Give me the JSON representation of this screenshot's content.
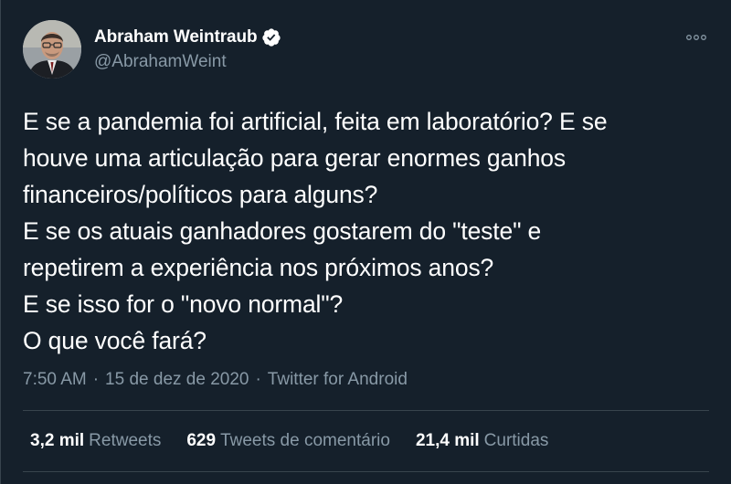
{
  "author": {
    "display_name": "Abraham Weintraub",
    "handle": "@AbrahamWeint",
    "verified": true,
    "avatar": "avatar-photo"
  },
  "tweet": {
    "lines": [
      "E se a pandemia foi artificial, feita em laboratório? E se",
      "houve uma articulação para gerar enormes ganhos",
      "financeiros/políticos para alguns?",
      "E se os atuais ganhadores gostarem do \"teste\" e",
      "repetirem a experiência nos próximos anos?",
      "E se isso for o \"novo normal\"?",
      "O que você fará?"
    ]
  },
  "meta": {
    "time": "7:50 AM",
    "separator": "·",
    "date": "15 de dez de 2020",
    "source": "Twitter for Android"
  },
  "stats": {
    "retweets": {
      "count": "3,2 mil",
      "label": "Retweets"
    },
    "quote_tweets": {
      "count": "629",
      "label": "Tweets de comentário"
    },
    "likes": {
      "count": "21,4 mil",
      "label": "Curtidas"
    }
  },
  "icons": {
    "more": "more-options-icon",
    "verified": "verified-badge-icon"
  },
  "colors": {
    "background": "#15202b",
    "text": "#ffffff",
    "secondary": "#8899a6",
    "divider": "#38444d",
    "verified_badge": "#ffffff"
  }
}
